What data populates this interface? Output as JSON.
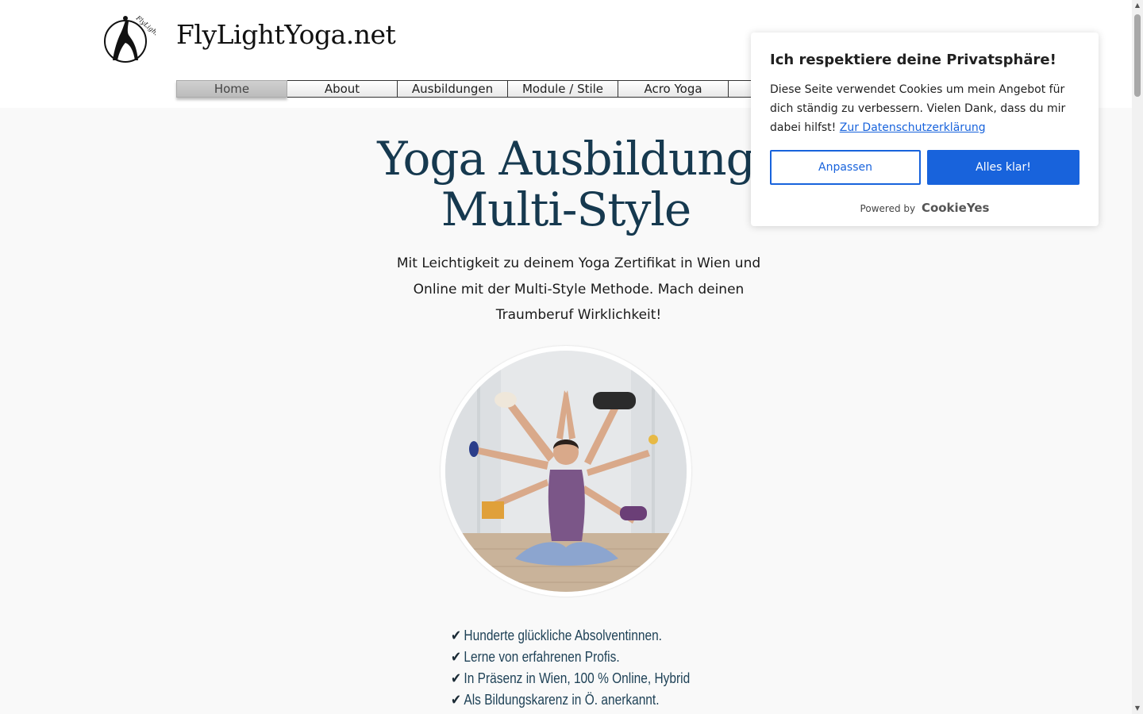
{
  "site": {
    "title": "FlyLightYoga.net",
    "logo_text": "FlyLight Yoga"
  },
  "nav": {
    "items": [
      "Home",
      "About",
      "Ausbildungen",
      "Module / Stile",
      "Acro Yoga"
    ],
    "active": "Home"
  },
  "hero": {
    "title_line1": "Yoga Ausbildung",
    "title_line2": "Multi-Style",
    "subtitle": "Mit Leichtigkeit zu deinem Yoga Zertifikat in Wien und Online mit der Multi-Style Methode. Mach deinen Traumberuf Wirklichkeit!"
  },
  "bullets": [
    "Hunderte glückliche Absolventinnen.",
    "Lerne von erfahrenen Profis.",
    "In Präsenz in Wien, 100 % Online, Hybrid",
    "Als Bildungskarenz in Ö. anerkannt."
  ],
  "cookie": {
    "title": "Ich respektiere deine Privatsphäre!",
    "text": "Diese Seite verwendet Cookies um mein Angebot für dich ständig zu verbessern. Vielen Dank, dass du mir dabei hilfst!",
    "link": "Zur Datenschutzerklärung",
    "customize": "Anpassen",
    "accept": "Alles klar!",
    "powered_by": "Powered by",
    "brand": "CookieYes"
  },
  "colors": {
    "accent": "#1863dc",
    "heading": "#16394f",
    "bullet_text": "#1f4257"
  },
  "icons": {
    "check": "check-icon",
    "logo": "yoga-pose-logo-icon"
  }
}
